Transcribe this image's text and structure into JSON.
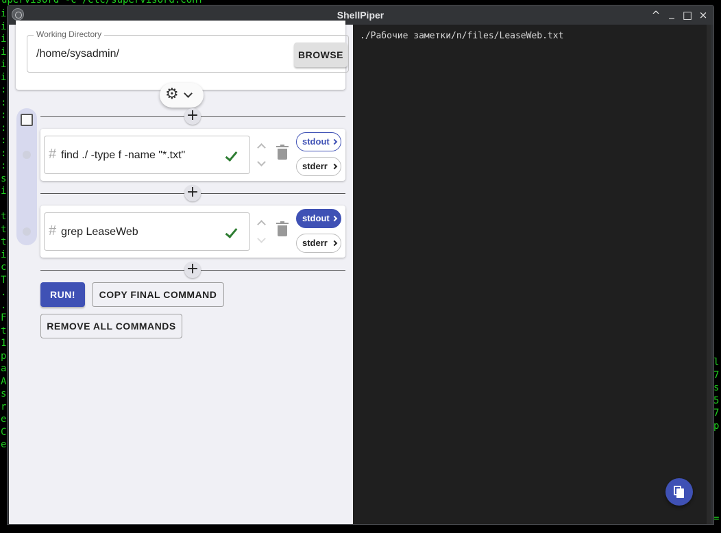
{
  "background_terminal": {
    "top_line": "upervisord -c /etc/supervisord.conf",
    "left_column": [
      "i",
      "i",
      "i",
      "i",
      "i",
      "i",
      ":",
      ":",
      ":",
      ":",
      ":",
      ":",
      ":",
      "s",
      "i",
      "",
      "t",
      "t",
      "t",
      "i",
      "c",
      "T",
      ".",
      ".",
      "F",
      "t",
      "1",
      "p",
      "a",
      "A",
      "s",
      "r",
      "e",
      "C",
      "e"
    ],
    "right_column": [
      "l",
      "7",
      "s",
      "5",
      "7",
      "p"
    ],
    "bottom_right": "="
  },
  "window": {
    "title": "ShellPiper",
    "controls": {
      "up": "^",
      "minimize": "_",
      "maximize": "□",
      "close": "×"
    }
  },
  "working_directory": {
    "label": "Working Directory",
    "value": "/home/sysadmin/",
    "browse_label": "BROWSE"
  },
  "settings": {
    "icon": "gear-icon",
    "chevron": "chevron-down-icon"
  },
  "commands": [
    {
      "text": "find ./ -type f -name \"*.txt\"",
      "valid": true,
      "stdout_label": "stdout",
      "stderr_label": "stderr",
      "stdout_selected": false
    },
    {
      "text": "grep LeaseWeb",
      "valid": true,
      "stdout_label": "stdout",
      "stderr_label": "stderr",
      "stdout_selected": true
    }
  ],
  "hash_symbol": "#",
  "add_symbol": "+",
  "actions": {
    "run_label": "RUN!",
    "copy_label": "COPY FINAL COMMAND",
    "remove_label": "REMOVE ALL COMMANDS"
  },
  "output": {
    "lines": [
      "./Рабочие заметки/n/files/LeaseWeb.txt"
    ]
  },
  "fab": {
    "icon": "copy-icon"
  },
  "colors": {
    "accent": "#3f51b5",
    "valid": "#2e7d32",
    "output_bg": "#1f1f1f",
    "panel_bg": "#f0f0f5",
    "terminal_green": "#1fd01f"
  }
}
